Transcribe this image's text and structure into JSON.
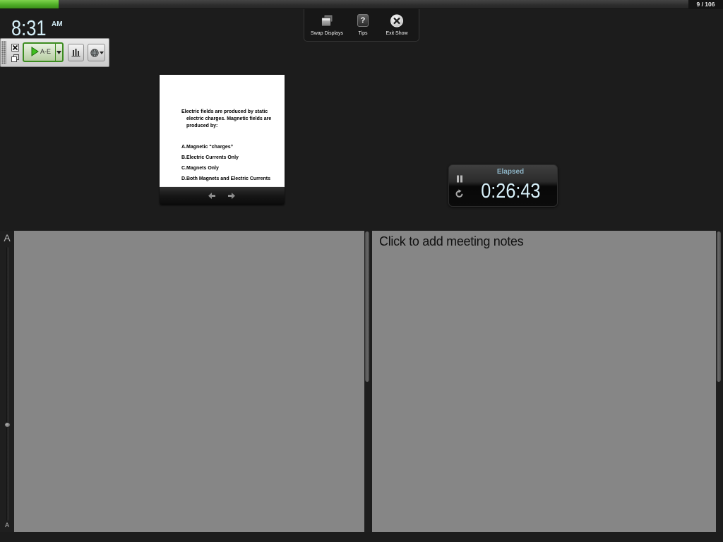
{
  "progress": {
    "slide_counter": "9 / 106",
    "fraction": 0.085
  },
  "clock": {
    "time": "8:31",
    "meridiem": "AM"
  },
  "presenter_toolbar": {
    "swap_displays": {
      "label": "Swap Displays",
      "icon": "swap-displays-icon"
    },
    "tips": {
      "label": "Tips",
      "icon": "help-icon",
      "glyph": "?"
    },
    "exit_show": {
      "label": "Exit Show",
      "icon": "close-circle-icon"
    }
  },
  "polling_toolbar": {
    "start_label": "A-E",
    "start_icon": "play-icon",
    "dropdown_icon": "chevron-down-icon",
    "chart_icon": "bar-chart-icon",
    "globe_icon": "globe-icon"
  },
  "current_slide": {
    "question": "Electric fields are produced by static electric charges. Magnetic fields are produced by:",
    "options": [
      "A.Magnetic “charges”",
      "B.Electric Currents Only",
      "C.Magnets Only",
      "D.Both Magnets and Electric Currents"
    ]
  },
  "slide_nav": {
    "previous_icon": "arrow-left-icon",
    "next_icon": "arrow-right-icon"
  },
  "timer": {
    "label": "Elapsed",
    "value": "0:26:43",
    "pause_icon": "pause-icon",
    "reset_icon": "reset-icon"
  },
  "font_size_slider": {
    "large_label": "A",
    "small_label": "A",
    "level": 0.35
  },
  "notes": {
    "meeting_notes_placeholder": "Click to add meeting notes"
  },
  "colors": {
    "background": "#1c1c1c",
    "progress_fill": "#4fae27",
    "clock_text": "#d3eef7",
    "timer_text": "#d8f1fa",
    "timer_label": "#8db4c6",
    "poll_button_border": "#3c8c1f",
    "notes_panel": "#868686",
    "notes_text": "#111111"
  }
}
